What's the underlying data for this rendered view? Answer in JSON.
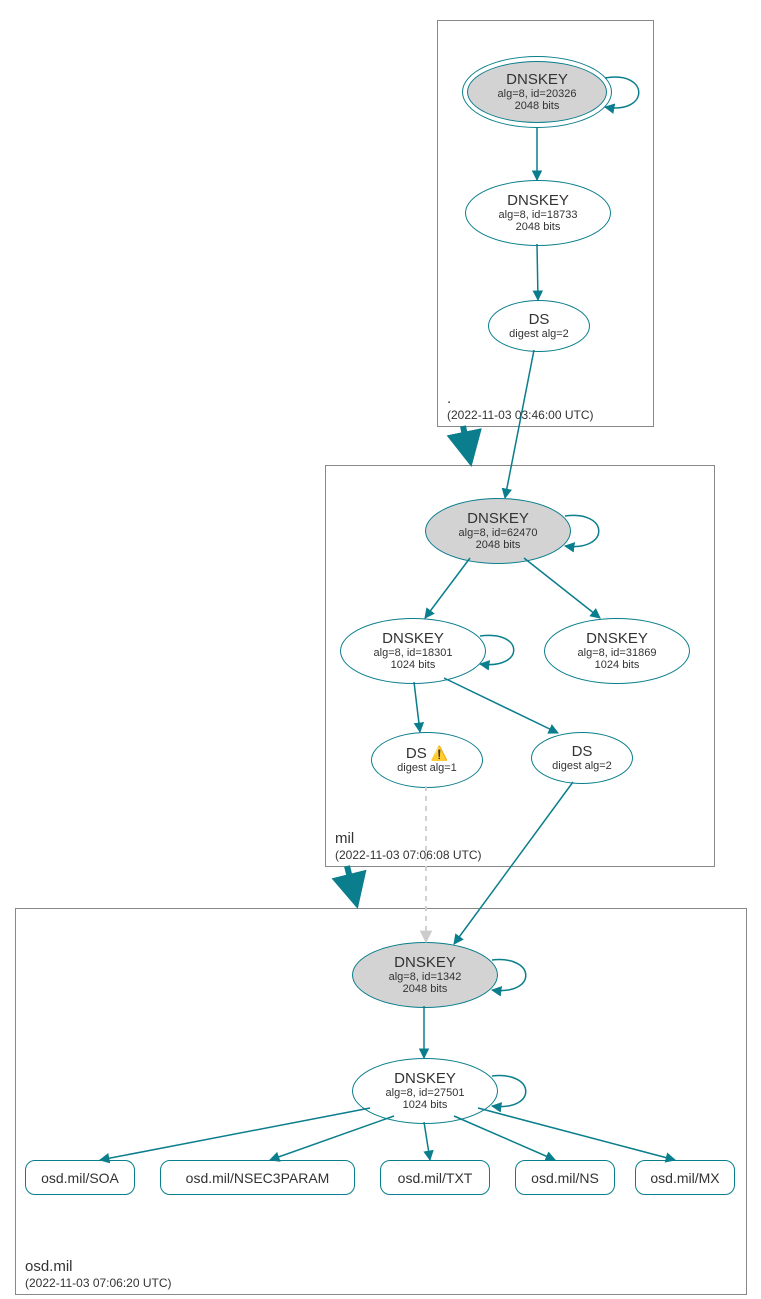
{
  "zones": {
    "root": {
      "label": ".",
      "timestamp": "(2022-11-03 03:46:00 UTC)"
    },
    "mil": {
      "label": "mil",
      "timestamp": "(2022-11-03 07:06:08 UTC)"
    },
    "osd": {
      "label": "osd.mil",
      "timestamp": "(2022-11-03 07:06:20 UTC)"
    }
  },
  "nodes": {
    "rootKSK": {
      "title": "DNSKEY",
      "sub1": "alg=8, id=20326",
      "sub2": "2048 bits"
    },
    "rootZSK": {
      "title": "DNSKEY",
      "sub1": "alg=8, id=18733",
      "sub2": "2048 bits"
    },
    "rootDS": {
      "title": "DS",
      "sub1": "digest alg=2"
    },
    "milKSK": {
      "title": "DNSKEY",
      "sub1": "alg=8, id=62470",
      "sub2": "2048 bits"
    },
    "milZSK1": {
      "title": "DNSKEY",
      "sub1": "alg=8, id=18301",
      "sub2": "1024 bits"
    },
    "milZSK2": {
      "title": "DNSKEY",
      "sub1": "alg=8, id=31869",
      "sub2": "1024 bits"
    },
    "milDS1": {
      "title": "DS",
      "sub1": "digest alg=1"
    },
    "milDS2": {
      "title": "DS",
      "sub1": "digest alg=2"
    },
    "osdKSK": {
      "title": "DNSKEY",
      "sub1": "alg=8, id=1342",
      "sub2": "2048 bits"
    },
    "osdZSK": {
      "title": "DNSKEY",
      "sub1": "alg=8, id=27501",
      "sub2": "1024 bits"
    }
  },
  "rr": {
    "soa": "osd.mil/SOA",
    "nsec3": "osd.mil/NSEC3PARAM",
    "txt": "osd.mil/TXT",
    "ns": "osd.mil/NS",
    "mx": "osd.mil/MX"
  },
  "icons": {
    "warning": "⚠️"
  },
  "colors": {
    "stroke": "#0a7e8c",
    "dashed": "#cccccc"
  }
}
